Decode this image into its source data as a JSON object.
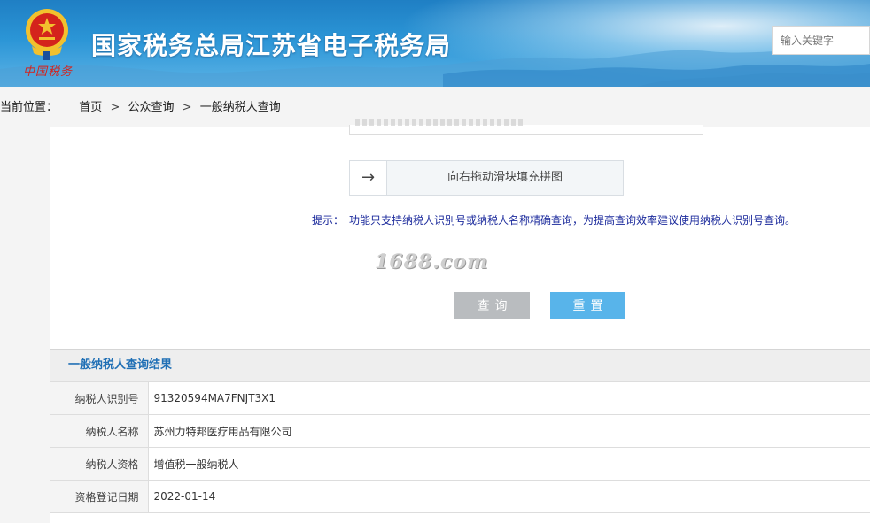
{
  "header": {
    "site_title": "国家税务总局江苏省电子税务局",
    "emblem_caption": "中国税务",
    "search_placeholder": "输入关键字",
    "colors": {
      "banner_top": "#1f7fc4",
      "banner_bottom": "#5cb3e6",
      "emblem_red": "#d4231c"
    }
  },
  "breadcrumb": {
    "prefix": "当前位置：",
    "items": [
      "首页",
      "公众查询",
      "一般纳税人查询"
    ],
    "separator": ">"
  },
  "form": {
    "slider_icon": "arrow-right-icon",
    "slider_text": "向右拖动滑块填充拼图",
    "tip_label": "提示：",
    "tip_text": "功能只支持纳税人识别号或纳税人名称精确查询，为提高查询效率建议使用纳税人识别号查询。",
    "watermark": "1688.com",
    "query_button": "查询",
    "reset_button": "重置",
    "colors": {
      "query_bg": "#b9bcbf",
      "reset_bg": "#58b4ea",
      "tip": "#1b2a9c"
    }
  },
  "result": {
    "title": "一般纳税人查询结果",
    "rows": [
      {
        "label": "纳税人识别号",
        "value": "91320594MA7FNJT3X1"
      },
      {
        "label": "纳税人名称",
        "value": "苏州力特邦医疗用品有限公司"
      },
      {
        "label": "纳税人资格",
        "value": "增值税一般纳税人"
      },
      {
        "label": "资格登记日期",
        "value": "2022-01-14"
      }
    ],
    "colors": {
      "title": "#1f6fb5"
    }
  }
}
